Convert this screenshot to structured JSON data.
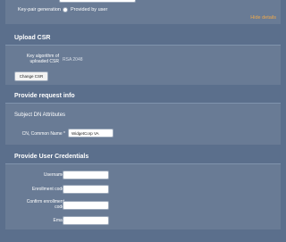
{
  "key_pair": {
    "label": "Key-pair generation",
    "option": "Provided by user",
    "hide_details": "Hide details"
  },
  "upload_csr": {
    "title": "Upload CSR",
    "key_algorithm_line1": "Key algorithm of",
    "key_algorithm_line2": "uploaded CSR",
    "key_algorithm_value": "RSA 2048",
    "change_button": "Change CSR"
  },
  "request_info": {
    "title": "Provide request info",
    "subject_heading": "Subject DN Attributes",
    "cn_label": "CN, Common Name *",
    "cn_value": "WidgetCorp VA"
  },
  "credentials": {
    "title": "Provide User Credentials",
    "username_label": "Username",
    "enrollment_code_label": "Enrollment code",
    "confirm_line1": "Confirm enrollment",
    "confirm_line2": "code",
    "email_label": "Email"
  }
}
